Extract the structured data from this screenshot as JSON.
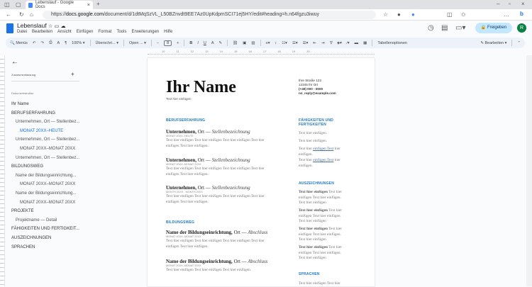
{
  "browser": {
    "tab_title": "Lebenslauf - Google Docs",
    "url_domain": "docs.google.com",
    "url_path": "/document/d/1dtMqSzVL_L50BZnvdt9EE7Az0UpKdpmSCI71ej5HY/edit#heading=h.n64fgzu3iwuy"
  },
  "doc": {
    "title": "Lebenslauf",
    "menu": [
      "Datei",
      "Bearbeiten",
      "Ansicht",
      "Einfügen",
      "Format",
      "Tools",
      "Erweiterungen",
      "Hilfe"
    ],
    "share_label": "Freigeben",
    "avatar_letter": "R"
  },
  "toolbar": {
    "menus": "Menüs",
    "zoom": "100%",
    "style": "Überschri...",
    "font": "Open ...",
    "font_size": "8",
    "table_options": "Tabellenoptionen",
    "mode": "Bearbeiten"
  },
  "ruler": [
    "10",
    "11",
    "12",
    "13",
    "14",
    "15",
    "16",
    "17",
    "18",
    "19",
    "20"
  ],
  "sidebar": {
    "summary_label": "Zusammenfassung",
    "structure_label": "Dokumentstruktur",
    "outline": [
      {
        "text": "Ihr Name",
        "level": 1
      },
      {
        "text": "BERUFSERFAHRUNG",
        "level": 1
      },
      {
        "text": "Unternehmen, Ort — Stellenbez...",
        "level": 2
      },
      {
        "text": "MONAT 20XX–HEUTE",
        "level": 3,
        "active": true
      },
      {
        "text": "Unternehmen, Ort — Stellenbez...",
        "level": 2
      },
      {
        "text": "MONAT 20XX–MONAT 20XX",
        "level": 3
      },
      {
        "text": "Unternehmen, Ort — Stellenbez...",
        "level": 2
      },
      {
        "text": "BILDUNGSWEG",
        "level": 1
      },
      {
        "text": "Name der Bildungseinrichtung...",
        "level": 2
      },
      {
        "text": "MONAT 20XX–MONAT 20XX",
        "level": 3
      },
      {
        "text": "Name der Bildungseinrichtung...",
        "level": 2
      },
      {
        "text": "MONAT 20XX–MONAT 20XX",
        "level": 3
      },
      {
        "text": "PROJEKTE",
        "level": 1
      },
      {
        "text": "Projektname — Detail",
        "level": 2
      },
      {
        "text": "FÄHIGKEITEN UND FERTIGKEIT...",
        "level": 1
      },
      {
        "text": "AUSZEICHNUNGEN",
        "level": 1
      },
      {
        "text": "SPRACHEN",
        "level": 1
      }
    ]
  },
  "page": {
    "name": "Ihr Name",
    "tagline": "Text hier einfügen",
    "contact": [
      "Ihre Straße 123",
      "12345 Ihr Ort",
      "(+49) 000 - 0000",
      "no_reply@example.com"
    ],
    "experience_heading": "BERUFSERFAHRUNG",
    "jobs": [
      {
        "company": "Unternehmen,",
        "place": "Ort —",
        "title": "Stellenbezeichnung",
        "date": "MONAT 20XX–HEUTE"
      },
      {
        "company": "Unternehmen,",
        "place": "Ort —",
        "title": "Stellenbezeichnung",
        "date": "MONAT 20XX–MONAT 20XX"
      },
      {
        "company": "Unternehmen,",
        "place": "Ort —",
        "title": "Stellenbezeichnung",
        "date": "MONTH 20XX - MONTH 20XX"
      }
    ],
    "body_text": "Text hier einfügen Text hier einfügen Text hier einfügen Text hier einfügen Text hier einfügen.",
    "education_heading": "BILDUNGSWEG",
    "schools": [
      {
        "name": "Name der Bildungseinrichtung,",
        "place": "Ort —",
        "degree": "Abschluss",
        "date": "MONAT 20XX–MONAT 20XX",
        "text": "Text hier einfügen Text hier einfügen Text hier einfügen Text hier einfügen Text hier einfügen."
      },
      {
        "name": "Name der Bildungseinrichtung,",
        "place": "Ort —",
        "degree": "Abschluss",
        "date": "MONAT 20XX–MONAT 20XX",
        "text": "Text hier einfügen Text hier einfügen Text hier einfügen."
      }
    ],
    "skills_heading": "FÄHIGKEITEN UND FERTIGKEITEN",
    "skills": [
      "Text hier einfügen.",
      "Text hier einfügen."
    ],
    "skill_link_pre": "Text hier",
    "skill_link": "einfügen Text",
    "skill_link_post": "hier einfügen.",
    "awards_heading": "AUSZEICHNUNGEN",
    "award_bold": "Text hier einfügen",
    "award_rest": "Text hier einfügen Text hier einfügen. Text hier einfügen",
    "languages_heading": "SPRACHEN",
    "language_text": "Text hier einfügen Text hier"
  }
}
